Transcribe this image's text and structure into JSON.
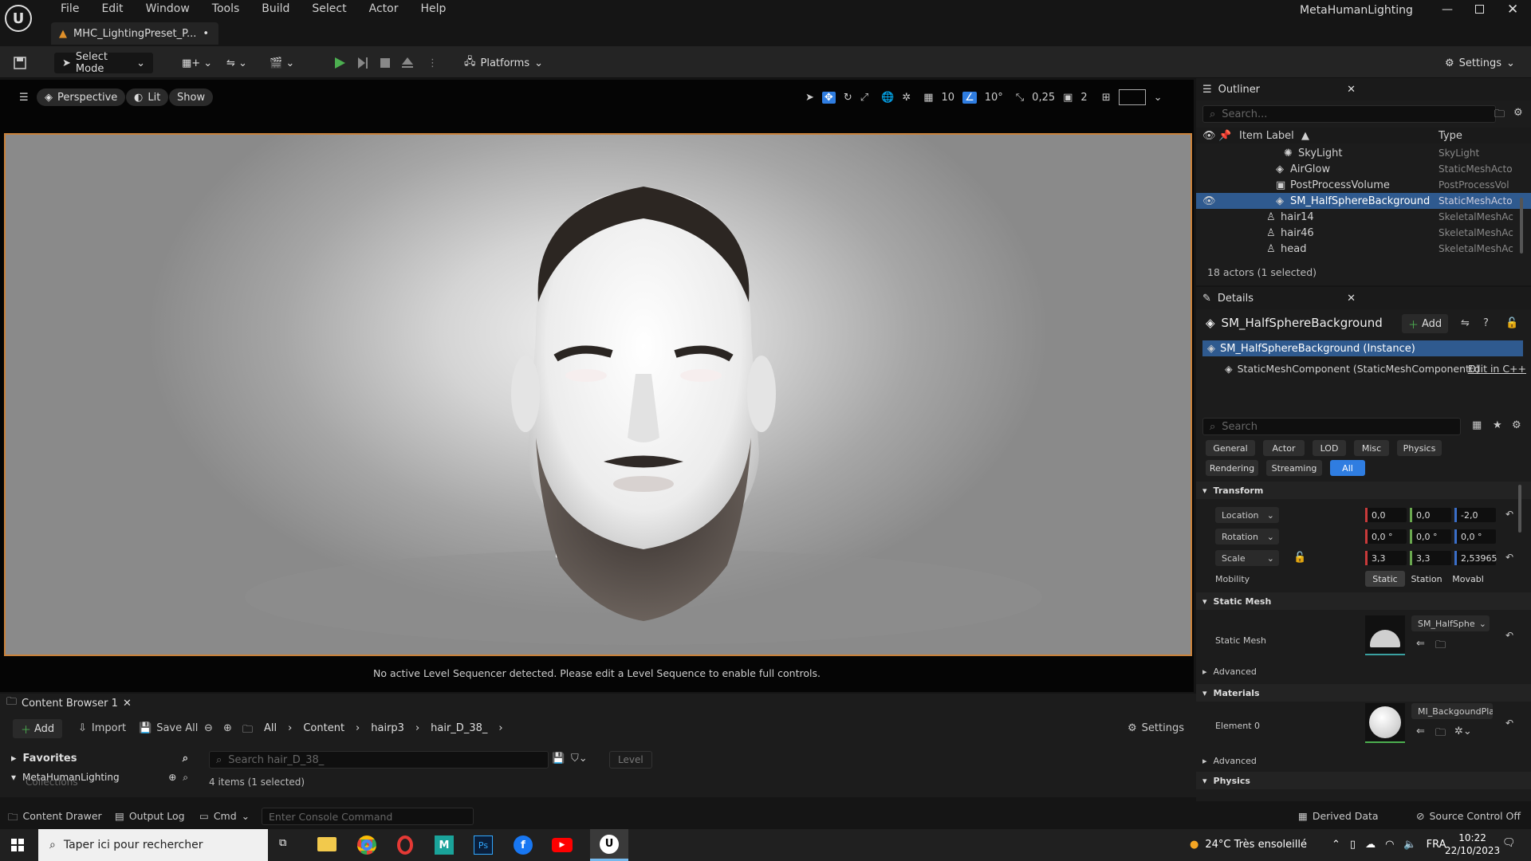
{
  "app": {
    "window_title": "MetaHumanLighting"
  },
  "menu": [
    "File",
    "Edit",
    "Window",
    "Tools",
    "Build",
    "Select",
    "Actor",
    "Help"
  ],
  "doc_tab": {
    "label": "MHC_LightingPreset_P...",
    "dirty": "•"
  },
  "toolbar": {
    "select_mode": "Select Mode",
    "platforms": "Platforms",
    "settings": "Settings"
  },
  "viewport": {
    "perspective": "Perspective",
    "lit": "Lit",
    "show": "Show",
    "grid_snap": "10",
    "angle_snap": "10°",
    "scale_snap": "0,25",
    "camera_speed": "2",
    "sequencer_msg": "No active Level Sequencer detected. Please edit a Level Sequence to enable full controls."
  },
  "outliner": {
    "title": "Outliner",
    "search_placeholder": "Search...",
    "col_label": "Item Label",
    "col_type": "Type",
    "items": [
      {
        "label": "SkyLight",
        "type": "SkyLight"
      },
      {
        "label": "AirGlow",
        "type": "StaticMeshActo"
      },
      {
        "label": "PostProcessVolume",
        "type": "PostProcessVol"
      },
      {
        "label": "SM_HalfSphereBackground",
        "type": "StaticMeshActo"
      },
      {
        "label": "hair14",
        "type": "SkeletalMeshAc"
      },
      {
        "label": "hair46",
        "type": "SkeletalMeshAc"
      },
      {
        "label": "head",
        "type": "SkeletalMeshAc"
      }
    ],
    "footer": "18 actors (1 selected)"
  },
  "details": {
    "title": "Details",
    "actor_name": "SM_HalfSphereBackground",
    "add": "Add",
    "instance": "SM_HalfSphereBackground (Instance)",
    "component": "StaticMeshComponent (StaticMeshComponent0)",
    "edit_cpp": "Edit in C++",
    "search_placeholder": "Search",
    "filters": [
      "General",
      "Actor",
      "LOD",
      "Misc",
      "Physics",
      "Rendering",
      "Streaming",
      "All"
    ],
    "transform": {
      "section": "Transform",
      "location_label": "Location",
      "location": [
        "0,0",
        "0,0",
        "-2,0"
      ],
      "rotation_label": "Rotation",
      "rotation": [
        "0,0 °",
        "0,0 °",
        "0,0 °"
      ],
      "scale_label": "Scale",
      "scale": [
        "3,3",
        "3,3",
        "2,53965"
      ],
      "mobility_label": "Mobility",
      "mobility": [
        "Static",
        "Station",
        "Movabl"
      ]
    },
    "static_mesh": {
      "section": "Static Mesh",
      "label": "Static Mesh",
      "asset": "SM_HalfSphe",
      "advanced": "Advanced"
    },
    "materials": {
      "section": "Materials",
      "label": "Element 0",
      "asset": "MI_BackgoundPlan",
      "advanced": "Advanced"
    },
    "physics": {
      "section": "Physics"
    }
  },
  "content_browser": {
    "tab": "Content Browser 1",
    "add": "Add",
    "import": "Import",
    "save_all": "Save All",
    "path": [
      "All",
      "Content",
      "hairp3",
      "hair_D_38_"
    ],
    "settings": "Settings",
    "favorites": "Favorites",
    "collections": "Collections",
    "project": "MetaHumanLighting",
    "search_placeholder": "Search hair_D_38_",
    "level_filter": "Level",
    "count": "4 items (1 selected)"
  },
  "statusbar": {
    "content_drawer": "Content Drawer",
    "output_log": "Output Log",
    "cmd": "Cmd",
    "console_placeholder": "Enter Console Command",
    "derived_data": "Derived Data",
    "source_control": "Source Control Off"
  },
  "taskbar": {
    "search_placeholder": "Taper ici pour rechercher",
    "weather": "24°C  Très ensoleillé",
    "lang": "FRA",
    "time": "10:22",
    "date": "22/10/2023"
  },
  "colors": {
    "accent": "#2f7de1",
    "selection_border": "#c9813a",
    "play_green": "#4caf50"
  }
}
